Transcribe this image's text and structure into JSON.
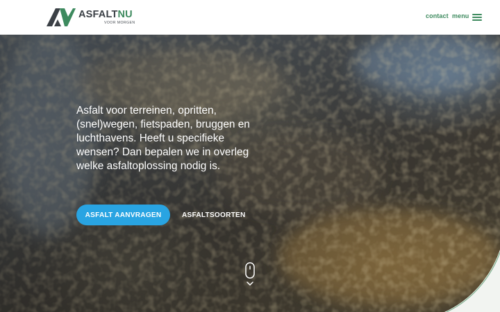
{
  "header": {
    "logo": {
      "word_dark": "ASFALT",
      "word_accent": "NU",
      "tagline": "VOOR MORGEN"
    },
    "nav": {
      "contact_label": "contact",
      "menu_label": "menu"
    }
  },
  "hero": {
    "text": "Asfalt voor terreinen, opritten, (snel)wegen, fietspaden, bruggen en luchthavens. Heeft u specifieke wensen? Dan bepalen we in overleg welke asfaltoplossing nodig is.",
    "primary_button_label": "ASFALT AANVRAGEN",
    "secondary_button_label": "ASFALTSOORTEN",
    "scroll_icon": "mouse-scroll-icon"
  },
  "colors": {
    "brand_green": "#3d8a5e",
    "brand_dark": "#3b4046",
    "button_blue": "#29a4e2",
    "header_bg": "#ffffff"
  }
}
